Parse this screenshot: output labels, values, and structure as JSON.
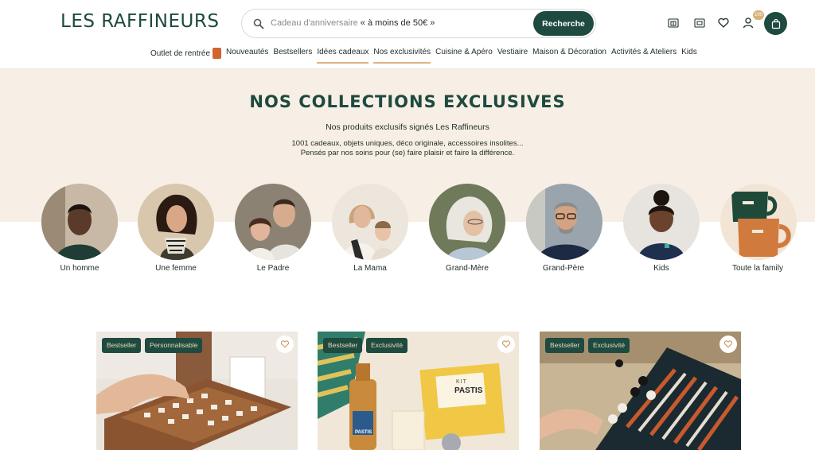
{
  "header": {
    "logo": "LES RAFFINEURS",
    "search_placeholder_prefix": "Cadeau d'anniversaire",
    "search_placeholder_suffix": "« à moins de 50€ »",
    "search_button": "Recherche",
    "cart_badge": "100"
  },
  "nav": [
    {
      "label": "Outlet de rentrée"
    },
    {
      "label": "Nouveautés"
    },
    {
      "label": "Bestsellers"
    },
    {
      "label": "Idées cadeaux"
    },
    {
      "label": "Nos exclusivités"
    },
    {
      "label": "Cuisine & Apéro"
    },
    {
      "label": "Vestiaire"
    },
    {
      "label": "Maison & Décoration"
    },
    {
      "label": "Activités & Ateliers"
    },
    {
      "label": "Kids"
    }
  ],
  "hero": {
    "title": "NOS COLLECTIONS EXCLUSIVES",
    "subtitle": "Nos produits exclusifs signés Les Raffineurs",
    "desc_line1": "1001 cadeaux, objets uniques, déco originale, accessoires insolites...",
    "desc_line2": "Pensés par nos soins pour (se) faire plaisir et faire la différence."
  },
  "collections": [
    {
      "label": "Un homme"
    },
    {
      "label": "Une femme"
    },
    {
      "label": "Le Padre"
    },
    {
      "label": "La Mama"
    },
    {
      "label": "Grand-Mère"
    },
    {
      "label": "Grand-Père"
    },
    {
      "label": "Kids"
    },
    {
      "label": "Toute la family"
    }
  ],
  "products": [
    {
      "tags": [
        "Bestseller",
        "Personnalisable"
      ]
    },
    {
      "tags": [
        "Bestseller",
        "Exclusivité"
      ],
      "kit_title": "KIT",
      "kit_name": "PASTIS",
      "bottle_label": "PASTIS"
    },
    {
      "tags": [
        "Bestseller",
        "Exclusivité"
      ]
    }
  ],
  "colors": {
    "brand": "#1e4a40",
    "accent": "#e0b37e",
    "hero_bg": "#f7efe6"
  }
}
